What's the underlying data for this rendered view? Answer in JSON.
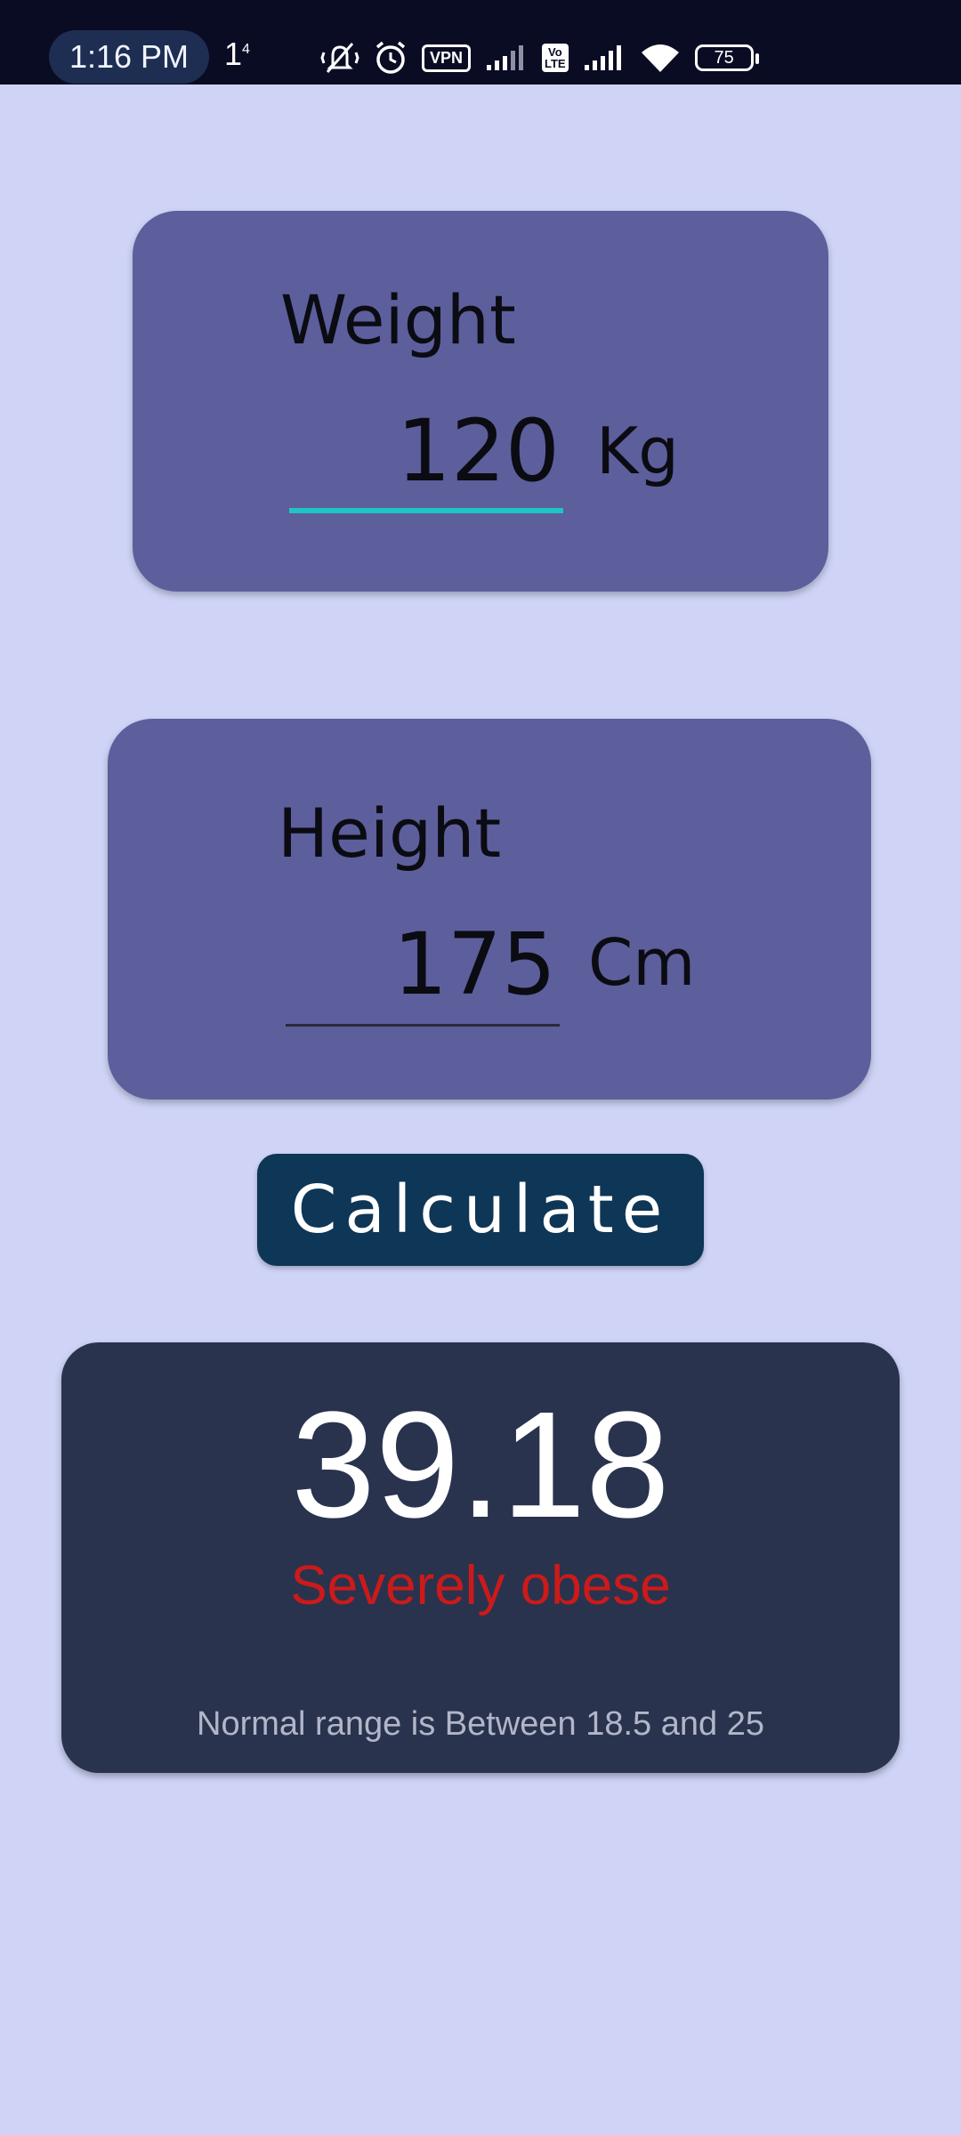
{
  "status_bar": {
    "time": "1:16 PM",
    "notification": "1",
    "notification_sup": "4",
    "vpn_label": "VPN",
    "volte_label_1": "Vo",
    "volte_label_2": "LTE",
    "battery_level": "75"
  },
  "weight": {
    "label": "Weight",
    "value": "120",
    "unit": "Kg"
  },
  "height": {
    "label": "Height",
    "value": "175",
    "unit": "Cm"
  },
  "calculate_label": "Calculate",
  "result": {
    "bmi": "39.18",
    "category": "Severely obese",
    "range_note": "Normal range is Between 18.5 and 25"
  },
  "colors": {
    "background": "#cfd4f7",
    "card": "#5d5e9c",
    "button": "#0e3656",
    "result_card": "#29334e",
    "category_text": "#cc1a1a",
    "focus_underline": "#1fc5c4"
  }
}
